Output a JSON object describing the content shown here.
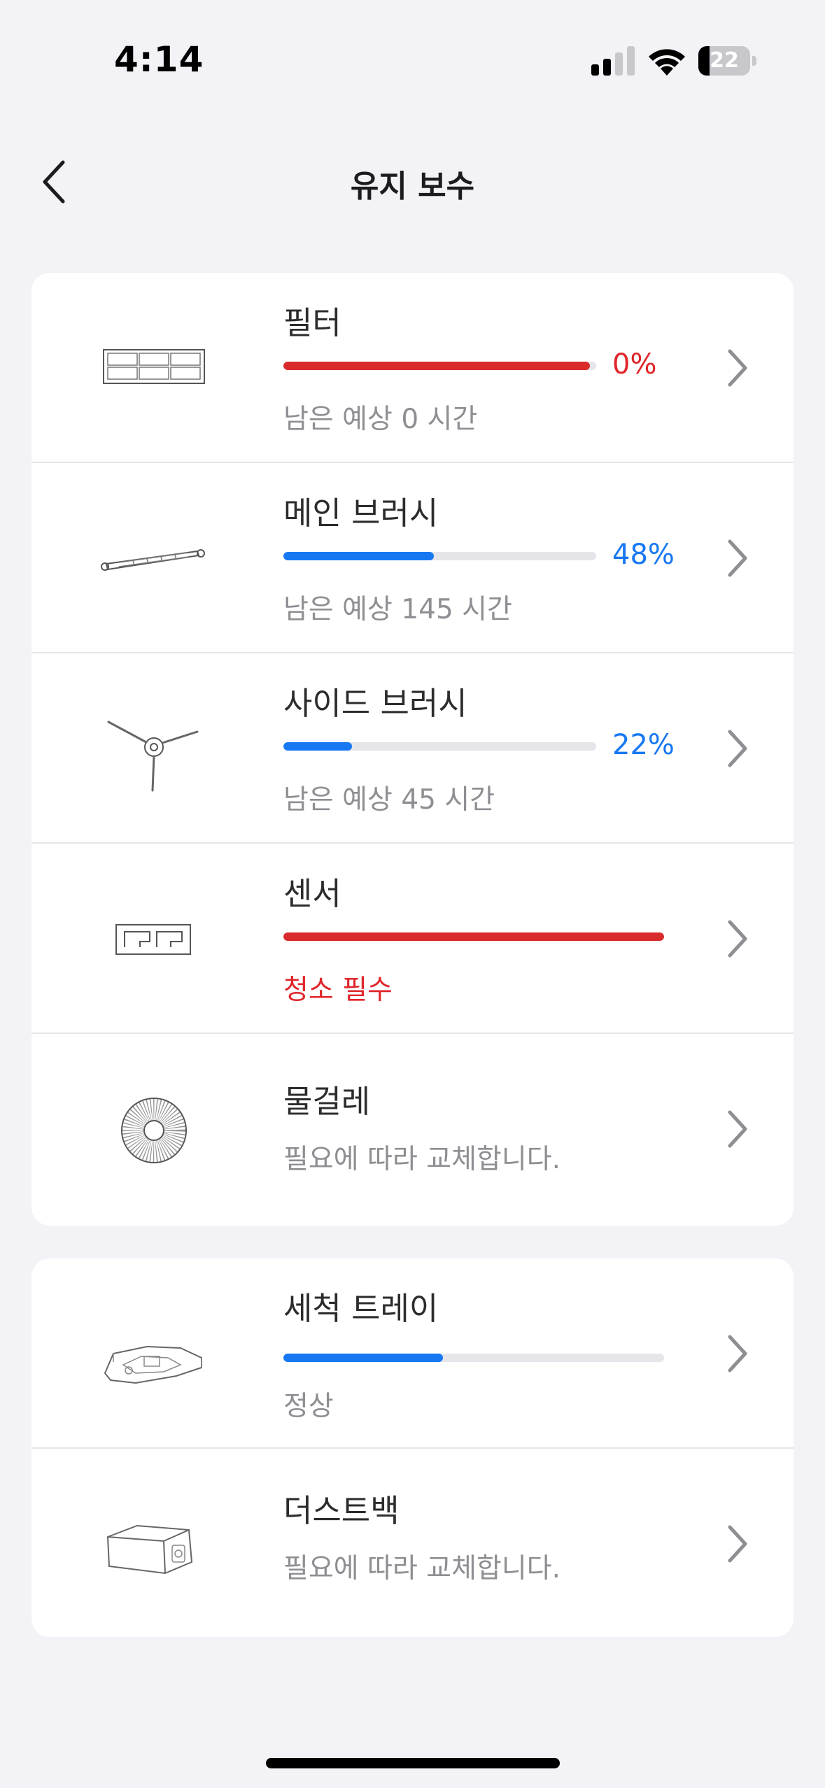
{
  "status_bar": {
    "time": "4:14",
    "battery": "22",
    "battery_level": 0.22
  },
  "nav": {
    "title": "유지 보수",
    "back_icon": "chevron-left-icon"
  },
  "colors": {
    "accent_blue": "#1778f2",
    "alert_red": "#e0262b",
    "background": "#f2f2f7"
  },
  "items": [
    {
      "title": "필터",
      "percent_label": "0%",
      "level": 0.98,
      "bar_color": "red",
      "subtitle": "남은 예상 0 시간",
      "icon": "filter-icon"
    },
    {
      "title": "메인 브러시",
      "percent_label": "48%",
      "level": 0.48,
      "bar_color": "blue",
      "subtitle": "남은 예상 145 시간",
      "icon": "main-brush-icon"
    },
    {
      "title": "사이드 브러시",
      "percent_label": "22%",
      "level": 0.22,
      "bar_color": "blue",
      "subtitle": "남은 예상 45 시간",
      "icon": "side-brush-icon"
    },
    {
      "title": "센서",
      "level": 1.0,
      "bar_color": "red",
      "subtitle": "청소 필수",
      "icon": "sensor-icon"
    },
    {
      "title": "물걸레",
      "subtitle": "필요에 따라 교체합니다.",
      "icon": "mop-icon"
    }
  ],
  "items2": [
    {
      "title": "세척 트레이",
      "level": 0.42,
      "bar_color": "blue",
      "subtitle": "정상",
      "icon": "wash-tray-icon"
    },
    {
      "title": "더스트백",
      "subtitle": "필요에 따라 교체합니다.",
      "icon": "dust-bag-icon"
    }
  ]
}
